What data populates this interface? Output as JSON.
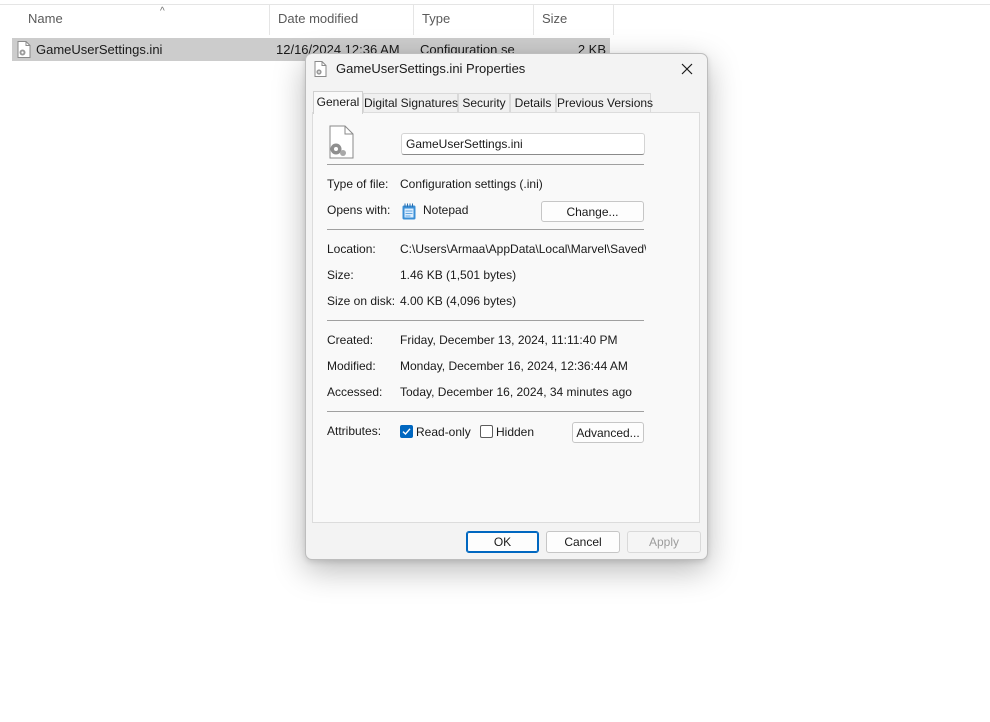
{
  "explorer": {
    "columns": [
      "Name",
      "Date modified",
      "Type",
      "Size"
    ],
    "sort_indicator": "^",
    "rows": [
      {
        "name": "GameUserSettings.ini",
        "date_modified": "12/16/2024 12:36 AM",
        "type": "Configuration se",
        "size": "2 KB"
      }
    ]
  },
  "dialog": {
    "title": "GameUserSettings.ini Properties",
    "tabs": [
      "General",
      "Digital Signatures",
      "Security",
      "Details",
      "Previous Versions"
    ],
    "active_tab": "General",
    "file_name": "GameUserSettings.ini",
    "fields": {
      "type_of_file_label": "Type of file:",
      "type_of_file": "Configuration settings (.ini)",
      "opens_with_label": "Opens with:",
      "opens_with": "Notepad",
      "change_button": "Change...",
      "location_label": "Location:",
      "location": "C:\\Users\\Armaa\\AppData\\Local\\Marvel\\Saved\\Co",
      "size_label": "Size:",
      "size": "1.46 KB (1,501 bytes)",
      "size_on_disk_label": "Size on disk:",
      "size_on_disk": "4.00 KB (4,096 bytes)",
      "created_label": "Created:",
      "created": "Friday, December 13, 2024, 11:11:40 PM",
      "modified_label": "Modified:",
      "modified": "Monday, December 16, 2024, 12:36:44 AM",
      "accessed_label": "Accessed:",
      "accessed": "Today, December 16, 2024, 34 minutes ago",
      "attributes_label": "Attributes:",
      "read_only_label": "Read-only",
      "read_only_checked": true,
      "hidden_label": "Hidden",
      "hidden_checked": false,
      "advanced_button": "Advanced..."
    },
    "buttons": {
      "ok": "OK",
      "cancel": "Cancel",
      "apply": "Apply"
    },
    "colors": {
      "accent": "#0067c0",
      "notepad_icon": "#3a8fd6"
    },
    "icons": [
      "config-file-icon",
      "notepad-icon",
      "close-icon",
      "checkmark-icon"
    ]
  }
}
